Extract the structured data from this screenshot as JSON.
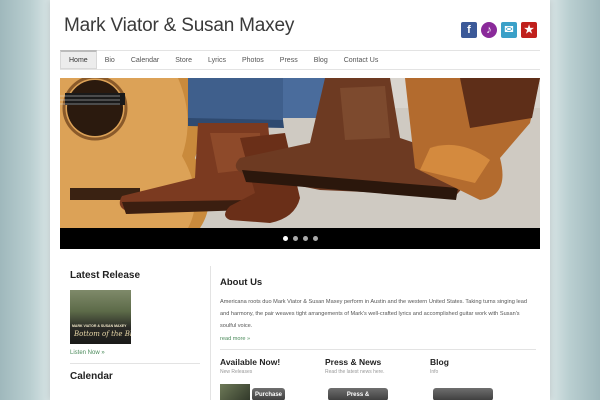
{
  "site": {
    "title": "Mark Viator & Susan Maxey"
  },
  "social": [
    {
      "icon": "facebook-icon",
      "glyph": "f"
    },
    {
      "icon": "podcast-icon",
      "glyph": "♪"
    },
    {
      "icon": "email-icon",
      "glyph": "✉"
    },
    {
      "icon": "reverbnation-icon",
      "glyph": "★"
    }
  ],
  "nav": {
    "items": [
      {
        "label": "Home",
        "active": true
      },
      {
        "label": "Bio"
      },
      {
        "label": "Calendar"
      },
      {
        "label": "Store"
      },
      {
        "label": "Lyrics"
      },
      {
        "label": "Photos"
      },
      {
        "label": "Press"
      },
      {
        "label": "Blog"
      },
      {
        "label": "Contact Us"
      }
    ]
  },
  "slider": {
    "dots": 4,
    "active_dot": 1
  },
  "sidebar": {
    "latest_release_heading": "Latest Release",
    "album_artist": "MARK VIATOR & SUSAN MAXEY",
    "album_title": "Bottom of the Blues",
    "listen_link": "Listen Now »",
    "calendar_heading": "Calendar"
  },
  "about": {
    "title": "About Us",
    "text": "Americana roots duo Mark Viator & Susan Maxey perform in Austin and the western United States. Taking turns singing lead and harmony, the pair weaves tight arrangements of Mark's well-crafted lyrics and accomplished guitar work with Susan's soulful voice.",
    "read_more": "read more »"
  },
  "columns": [
    {
      "title": "Available Now!",
      "subtitle": "New Releases",
      "button": "Purchase"
    },
    {
      "title": "Press & News",
      "subtitle": "Read the latest news here.",
      "button": "Press &"
    },
    {
      "title": "Blog",
      "subtitle": "Info",
      "button": ""
    }
  ],
  "colors": {
    "link": "#4a8a5a",
    "nav_active_bg": "#ececec",
    "slider_bar": "#000000"
  }
}
